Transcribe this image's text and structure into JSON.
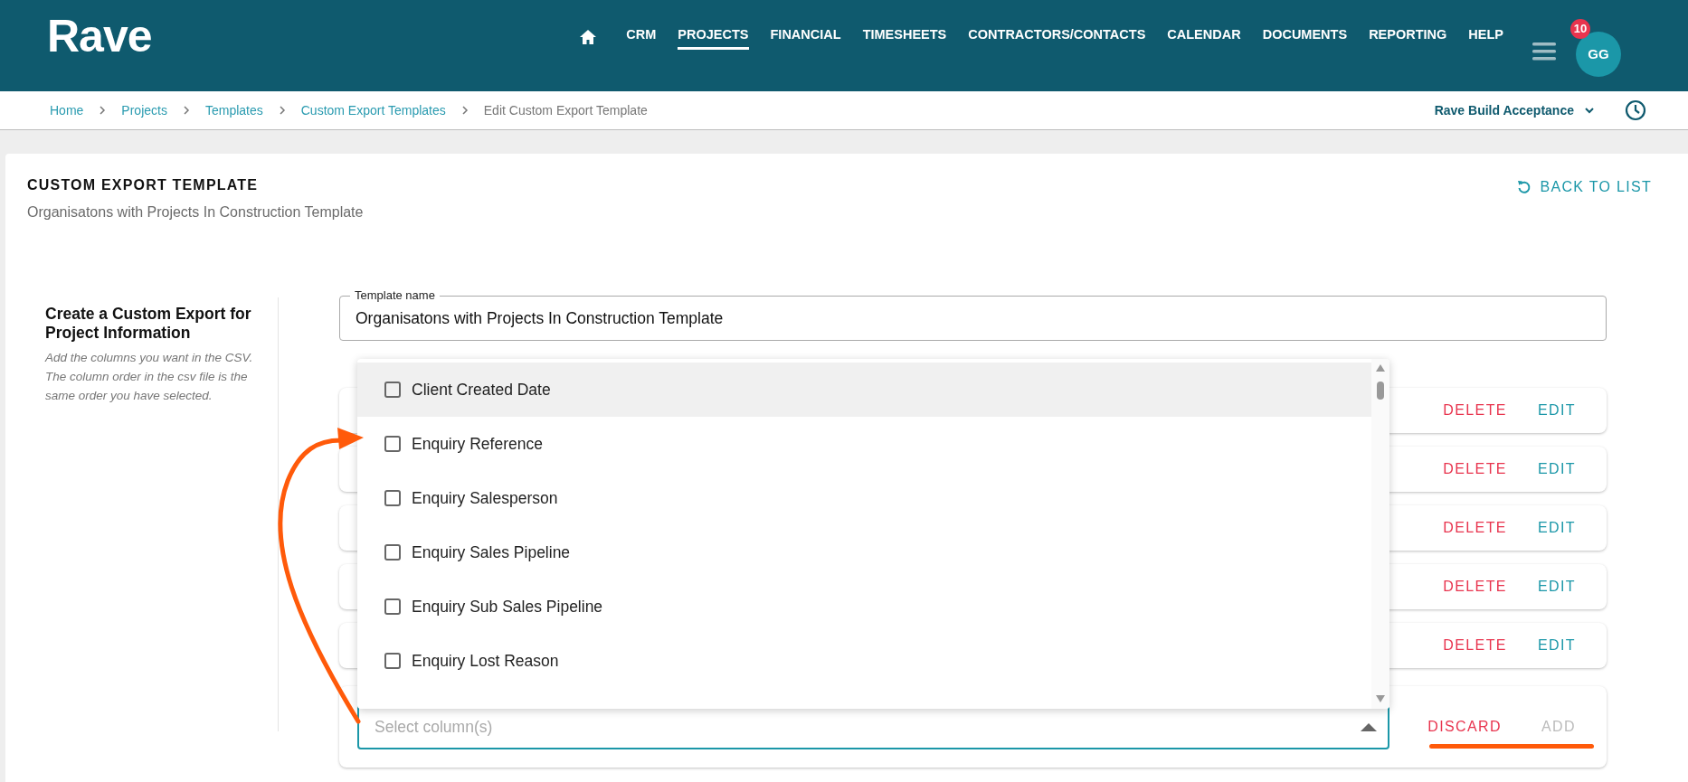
{
  "header": {
    "logo": "Rave",
    "nav": [
      {
        "label": "CRM",
        "selected": false
      },
      {
        "label": "PROJECTS",
        "selected": true
      },
      {
        "label": "FINANCIAL",
        "selected": false
      },
      {
        "label": "TIMESHEETS",
        "selected": false
      },
      {
        "label": "CONTRACTORS/CONTACTS",
        "selected": false
      },
      {
        "label": "CALENDAR",
        "selected": false
      },
      {
        "label": "DOCUMENTS",
        "selected": false
      },
      {
        "label": "REPORTING",
        "selected": false
      },
      {
        "label": "HELP",
        "selected": false
      }
    ],
    "notification_count": "10",
    "avatar_initials": "GG"
  },
  "breadcrumbs": [
    "Home",
    "Projects",
    "Templates",
    "Custom Export Templates",
    "Edit Custom Export Template"
  ],
  "workspace": "Rave Build Acceptance",
  "page": {
    "title": "CUSTOM EXPORT TEMPLATE",
    "subtitle": "Organisatons with Projects In Construction Template",
    "back_button": "BACK TO LIST"
  },
  "intro": {
    "heading": "Create a Custom Export for Project Information",
    "description": "Add the columns you want in the CSV. The column order in the csv file is the same order you have selected."
  },
  "template_name": {
    "label": "Template name",
    "value": "Organisatons with Projects In Construction Template"
  },
  "column_rows": [
    {
      "delete": "DELETE",
      "edit": "EDIT"
    },
    {
      "delete": "DELETE",
      "edit": "EDIT"
    },
    {
      "delete": "DELETE",
      "edit": "EDIT"
    },
    {
      "delete": "DELETE",
      "edit": "EDIT"
    },
    {
      "delete": "DELETE",
      "edit": "EDIT"
    }
  ],
  "columns_field": {
    "placeholder": "Select column(s)",
    "expanded": true
  },
  "column_options": [
    {
      "label": "Client Created Date",
      "checked": false,
      "highlighted": true
    },
    {
      "label": "Enquiry Reference",
      "checked": false,
      "highlighted": false
    },
    {
      "label": "Enquiry Salesperson",
      "checked": false,
      "highlighted": false
    },
    {
      "label": "Enquiry Sales Pipeline",
      "checked": false,
      "highlighted": false
    },
    {
      "label": "Enquiry Sub Sales Pipeline",
      "checked": false,
      "highlighted": false
    },
    {
      "label": "Enquiry Lost Reason",
      "checked": false,
      "highlighted": false
    }
  ],
  "actions": {
    "discard": "DISCARD",
    "add": "ADD",
    "add_disabled": true
  }
}
